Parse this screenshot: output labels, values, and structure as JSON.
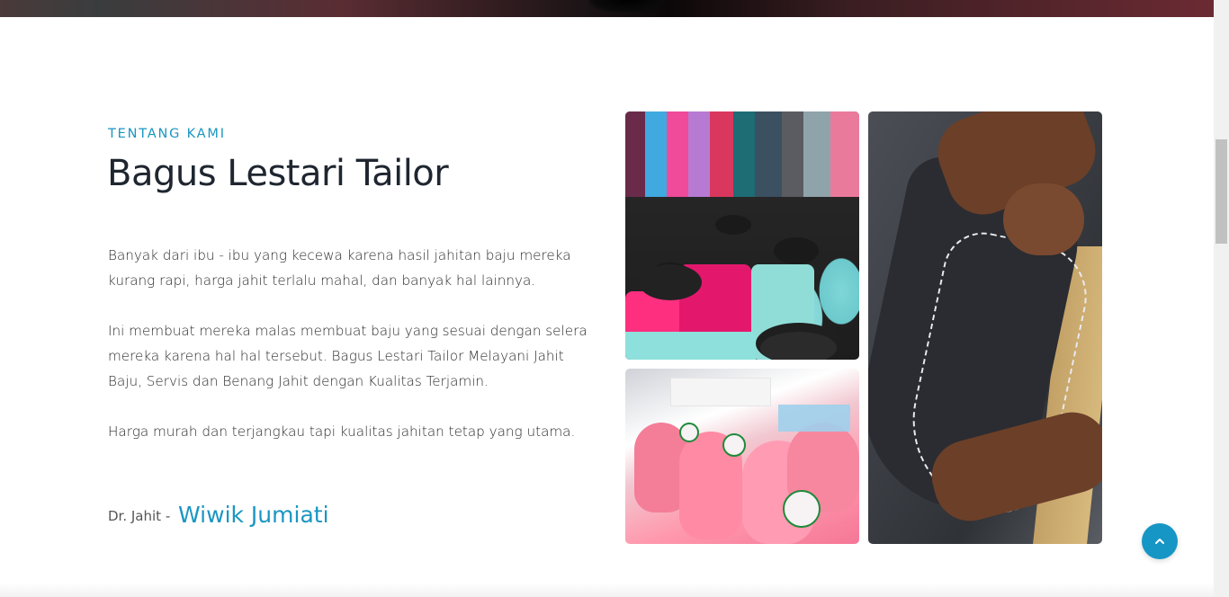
{
  "about": {
    "eyebrow": "TENTANG KAMI",
    "title": "Bagus Lestari Tailor",
    "paragraphs": [
      "Banyak dari ibu - ibu yang kecewa karena hasil jahitan baju mereka kurang rapi, harga jahit terlalu mahal, dan banyak hal lainnya.",
      "Ini membuat mereka malas membuat baju yang sesuai dengan selera mereka karena hal hal tersebut. Bagus Lestari Tailor Melayani Jahit Baju, Servis dan Benang Jahit dengan Kualitas Terjamin.",
      "Harga murah dan terjangkau tapi kualitas jahitan tetap yang utama."
    ],
    "signature": {
      "role": "Dr. Jahit - ",
      "name": "Wiwik Jumiati"
    }
  },
  "images": {
    "spools": "colorful thread spools photo",
    "pink_threads": "pink thread cones photo",
    "suit_sewing": "hand stitching suit fabric photo"
  },
  "back_to_top": {
    "icon": "chevron-up-icon"
  },
  "colors": {
    "accent": "#1a96c2",
    "text": "#2c2c2c",
    "heading": "#1f2630",
    "button": "#1696c5"
  }
}
